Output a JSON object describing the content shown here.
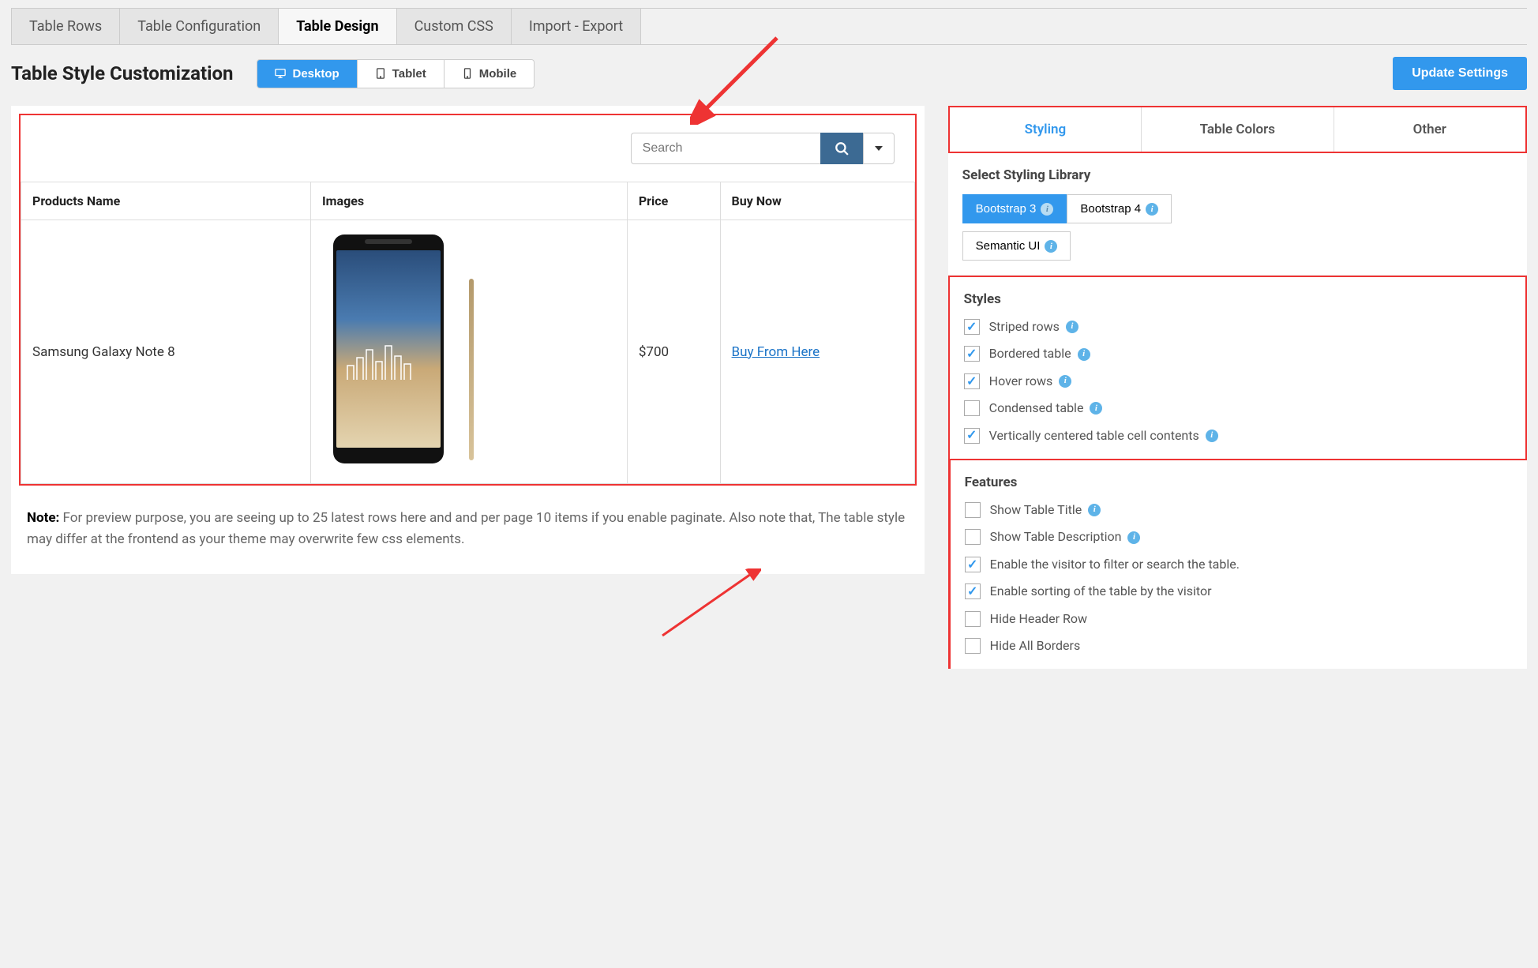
{
  "tabs": [
    "Table Rows",
    "Table Configuration",
    "Table Design",
    "Custom CSS",
    "Import - Export"
  ],
  "active_tab": 2,
  "page_title": "Table Style Customization",
  "devices": [
    "Desktop",
    "Tablet",
    "Mobile"
  ],
  "active_device": 0,
  "update_button": "Update Settings",
  "search": {
    "placeholder": "Search"
  },
  "table": {
    "headers": [
      "Products Name",
      "Images",
      "Price",
      "Buy Now"
    ],
    "rows": [
      {
        "name": "Samsung Galaxy Note 8",
        "price": "$700",
        "buy": "Buy From Here"
      }
    ]
  },
  "note_label": "Note:",
  "note_text": "For preview purpose, you are seeing up to 25 latest rows here and and per page 10 items if you enable paginate. Also note that, The table style may differ at the frontend as your theme may overwrite few css elements.",
  "side_tabs": [
    "Styling",
    "Table Colors",
    "Other"
  ],
  "active_side_tab": 0,
  "styling_library": {
    "title": "Select Styling Library",
    "options": [
      "Bootstrap 3",
      "Bootstrap 4",
      "Semantic UI"
    ],
    "active": 0
  },
  "styles_section": {
    "title": "Styles",
    "items": [
      {
        "label": "Striped rows",
        "checked": true,
        "info": true
      },
      {
        "label": "Bordered table",
        "checked": true,
        "info": true
      },
      {
        "label": "Hover rows",
        "checked": true,
        "info": true
      },
      {
        "label": "Condensed table",
        "checked": false,
        "info": true
      },
      {
        "label": "Vertically centered table cell contents",
        "checked": true,
        "info": true
      }
    ]
  },
  "features_section": {
    "title": "Features",
    "items": [
      {
        "label": "Show Table Title",
        "checked": false,
        "info": true
      },
      {
        "label": "Show Table Description",
        "checked": false,
        "info": true
      },
      {
        "label": "Enable the visitor to filter or search the table.",
        "checked": true,
        "info": false
      },
      {
        "label": "Enable sorting of the table by the visitor",
        "checked": true,
        "info": false
      },
      {
        "label": "Hide Header Row",
        "checked": false,
        "info": false
      },
      {
        "label": "Hide All Borders",
        "checked": false,
        "info": false
      }
    ]
  }
}
